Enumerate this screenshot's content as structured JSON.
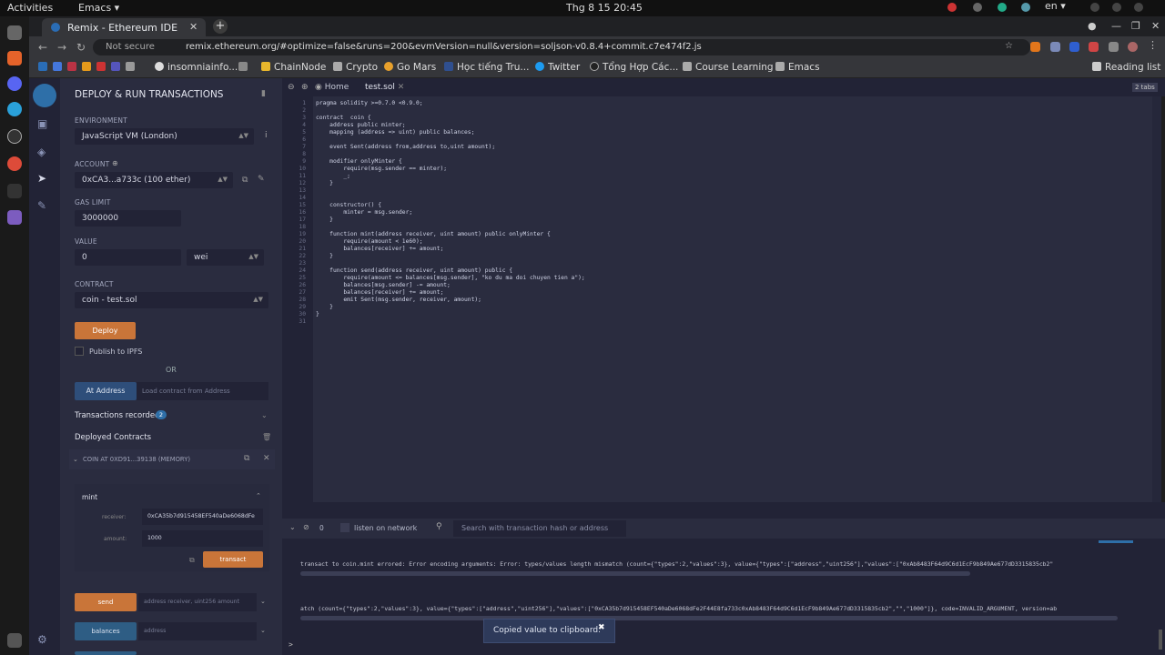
{
  "gnome": {
    "activities": "Activities",
    "app": "Emacs ▾",
    "clock": "Thg 8 15  20:45",
    "lang": "en ▾"
  },
  "browser": {
    "tab_title": "Remix - Ethereum IDE",
    "not_secure": "Not secure",
    "url": "remix.ethereum.org/#optimize=false&runs=200&evmVersion=null&version=soljson-v0.8.4+commit.c7e474f2.js",
    "bookmarks": [
      "insomniainfo...",
      "ChainNode",
      "Crypto",
      "Go Mars",
      "Học tiếng Tru...",
      "Twitter",
      "Tổng Hợp Các...",
      "Course Learning",
      "Emacs"
    ],
    "reading_list": "Reading list"
  },
  "panel": {
    "title": "DEPLOY & RUN TRANSACTIONS",
    "env_label": "ENVIRONMENT",
    "env_value": "JavaScript VM (London)",
    "account_label": "ACCOUNT",
    "account_value": "0xCA3...a733c (100 ether)",
    "gas_label": "GAS LIMIT",
    "gas_value": "3000000",
    "value_label": "VALUE",
    "value_value": "0",
    "value_unit": "wei",
    "contract_label": "CONTRACT",
    "contract_value": "coin - test.sol",
    "deploy": "Deploy",
    "publish": "Publish to IPFS",
    "or": "OR",
    "at_address": "At Address",
    "load_placeholder": "Load contract from Address",
    "tx_recorded": "Transactions recorded",
    "tx_count": "2",
    "deployed": "Deployed Contracts",
    "instance": "COIN AT 0XD91...39138 (MEMORY)",
    "mint": "mint",
    "receiver_label": "receiver:",
    "receiver_value": "0xCA35b7d915458EF540aDe6068dFe",
    "amount_label": "amount:",
    "amount_value": "1000",
    "transact": "transact",
    "send": "send",
    "send_placeholder": "address receiver, uint256 amount",
    "balances": "balances",
    "balances_placeholder": "address"
  },
  "editor": {
    "tabs": [
      "Home",
      "test.sol"
    ],
    "tabs_badge": "2 tabs",
    "lines": [
      "pragma solidity >=0.7.0 <0.9.0;",
      "",
      "contract  coin {",
      "    address public minter;",
      "    mapping (address => uint) public balances;",
      "",
      "    event Sent(address from,address to,uint amount);",
      "",
      "    modifier onlyMinter {",
      "        require(msg.sender == minter);",
      "        _;",
      "    }",
      "",
      "",
      "    constructor() {",
      "        minter = msg.sender;",
      "    }",
      "",
      "    function mint(address receiver, uint amount) public onlyMinter {",
      "        require(amount < 1e60);",
      "        balances[receiver] += amount;",
      "    }",
      "",
      "    function send(address receiver, uint amount) public {",
      "        require(amount <= balances[msg.sender], \"ko du ma doi chuyen tien a\");",
      "        balances[msg.sender] -= amount;",
      "        balances[receiver] += amount;",
      "        emit Sent(msg.sender, receiver, amount);",
      "    }",
      "}",
      ""
    ]
  },
  "terminal": {
    "count": "0",
    "listen": "listen on network",
    "search_placeholder": "Search with transaction hash or address",
    "line1": "transact to coin.mint errored: Error encoding arguments: Error: types/values length mismatch (count={\"types\":2,\"values\":3}, value={\"types\":[\"address\",\"uint256\"],\"values\":[\"0xAb8483F64d9C6d1EcF9b849Ae677dD3315835cb2\"",
    "line2": "atch (count={\"types\":2,\"values\":3}, value={\"types\":[\"address\",\"uint256\"],\"values\":[\"0xCA35b7d915458EF540aDe6068dFe2F44E8fa733c0xAb8483F64d9C6d1EcF9b849Ae677dD3315835cb2\",\"\",\"1000\"]}, code=INVALID_ARGUMENT, version=ab",
    "prompt": ">",
    "toast": "Copied value to clipboard."
  }
}
